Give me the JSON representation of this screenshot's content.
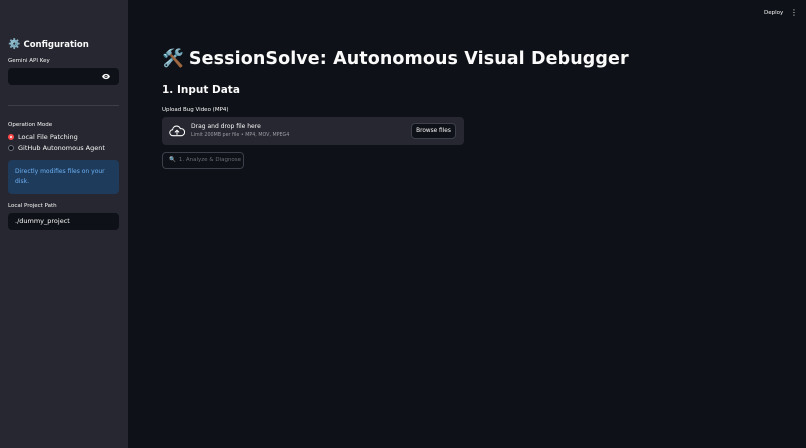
{
  "sidebar": {
    "title": "Configuration",
    "title_icon": "gear-icon",
    "api_key_label": "Gemini API Key",
    "api_key_value": "",
    "operation_mode_label": "Operation Mode",
    "modes": [
      {
        "label": "Local File Patching",
        "selected": true
      },
      {
        "label": "GitHub Autonomous Agent",
        "selected": false
      }
    ],
    "info_text": "Directly modifies files on your disk.",
    "project_path_label": "Local Project Path",
    "project_path_value": "./dummy_project"
  },
  "header": {
    "deploy_label": "Deploy",
    "menu_icon": "vertical-dots-icon"
  },
  "main": {
    "title_icon": "hammer-wrench-icon",
    "title": "SessionSolve: Autonomous Visual Debugger",
    "section_title": "1. Input Data",
    "upload_label": "Upload Bug Video (MP4)",
    "dropzone_title": "Drag and drop file here",
    "dropzone_subtitle": "Limit 200MB per file • MP4, MOV, MPEG4",
    "browse_label": "Browse files",
    "analyze_label": "1. Analyze & Diagnose",
    "analyze_icon": "magnifier-icon"
  },
  "colors": {
    "background": "#0e1117",
    "sidebar": "#262730",
    "accent": "#ff4b4b",
    "info_bg": "#1f3b5c",
    "info_text": "#6ab0f3"
  }
}
